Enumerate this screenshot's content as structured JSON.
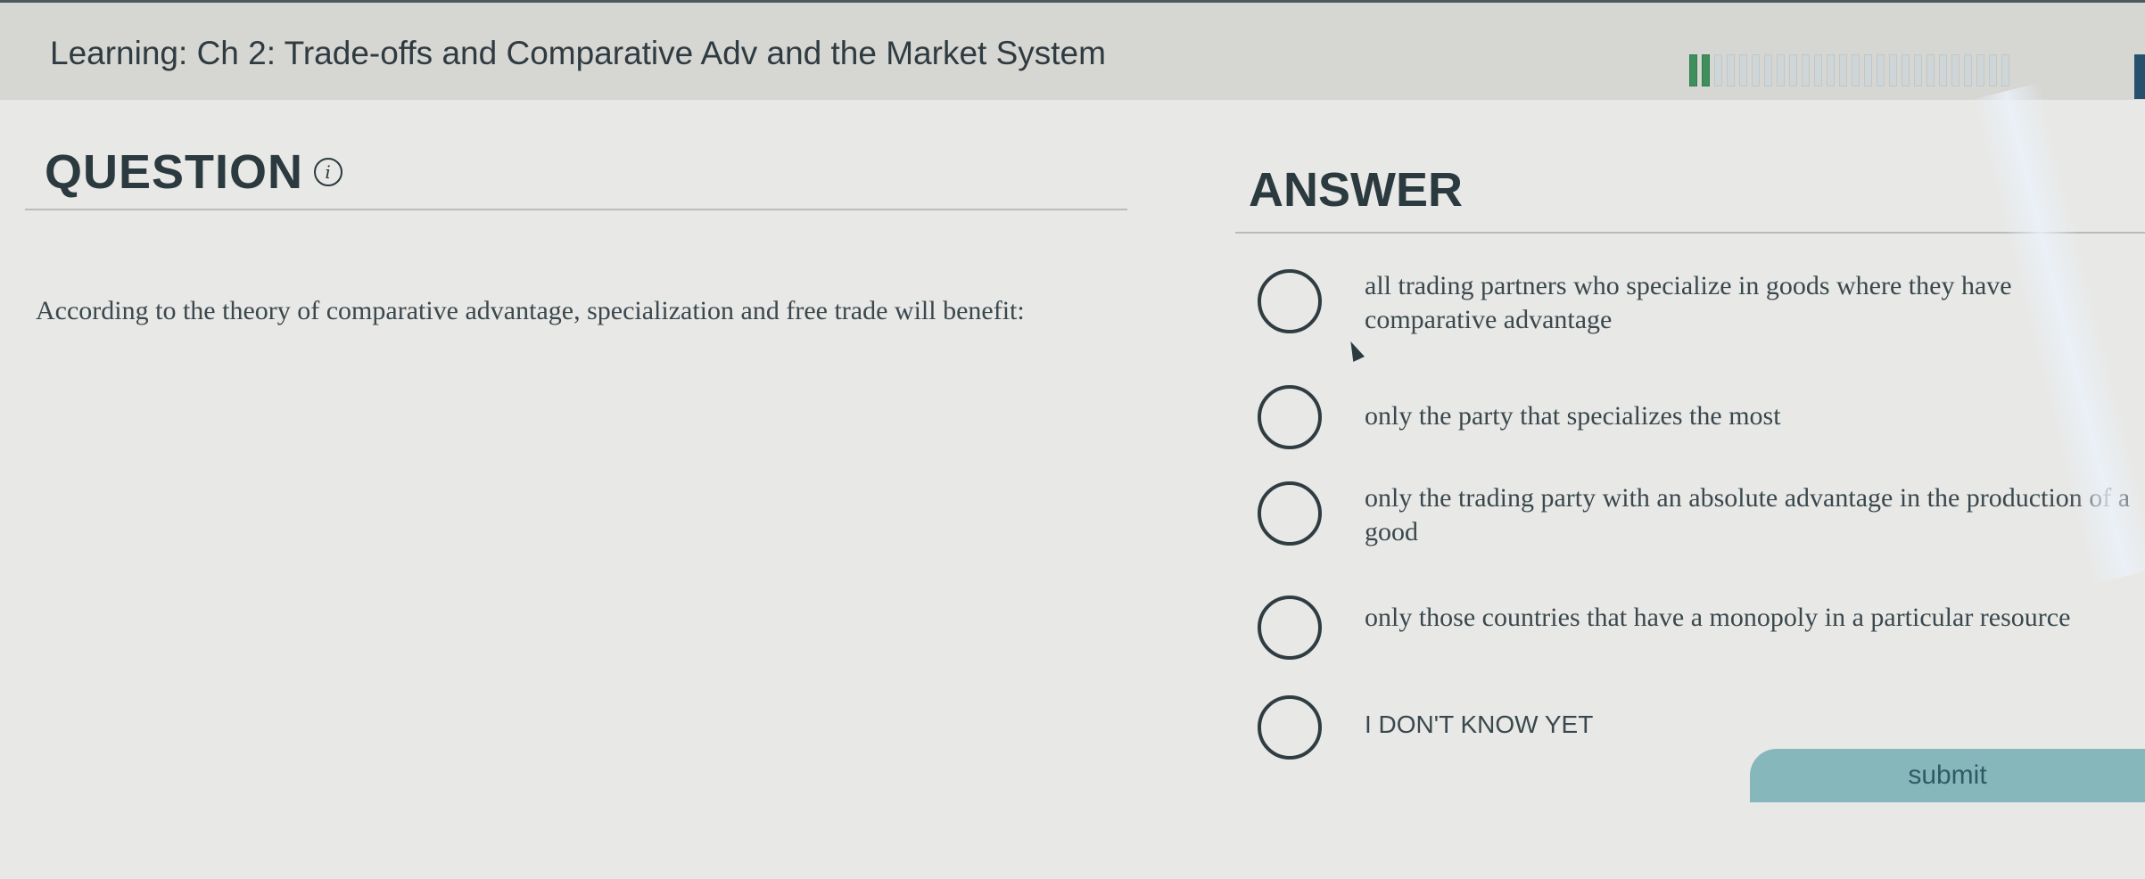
{
  "header": {
    "course_title": "Learning: Ch 2: Trade-offs and Comparative Adv and the Market System",
    "progress": {
      "completed_segments": 2,
      "total_segments": 26
    }
  },
  "question": {
    "heading": "QUESTION",
    "info_icon": "i",
    "text": "According to the theory of comparative advantage, specialization and free trade will benefit:"
  },
  "answer": {
    "heading": "ANSWER",
    "options": [
      {
        "label": "all trading partners who specialize in goods where they have comparative advantage"
      },
      {
        "label": "only the party that specializes the most"
      },
      {
        "label": "only the trading party with an absolute advantage in the production of a good"
      },
      {
        "label": "only those countries that have a monopoly in a particular resource"
      },
      {
        "label": "I DON'T KNOW YET"
      }
    ]
  },
  "submit": {
    "label": "submit"
  },
  "colors": {
    "accent": "#86b7bb",
    "progress_done": "#3f8f5d",
    "text": "#2b3a3f"
  }
}
